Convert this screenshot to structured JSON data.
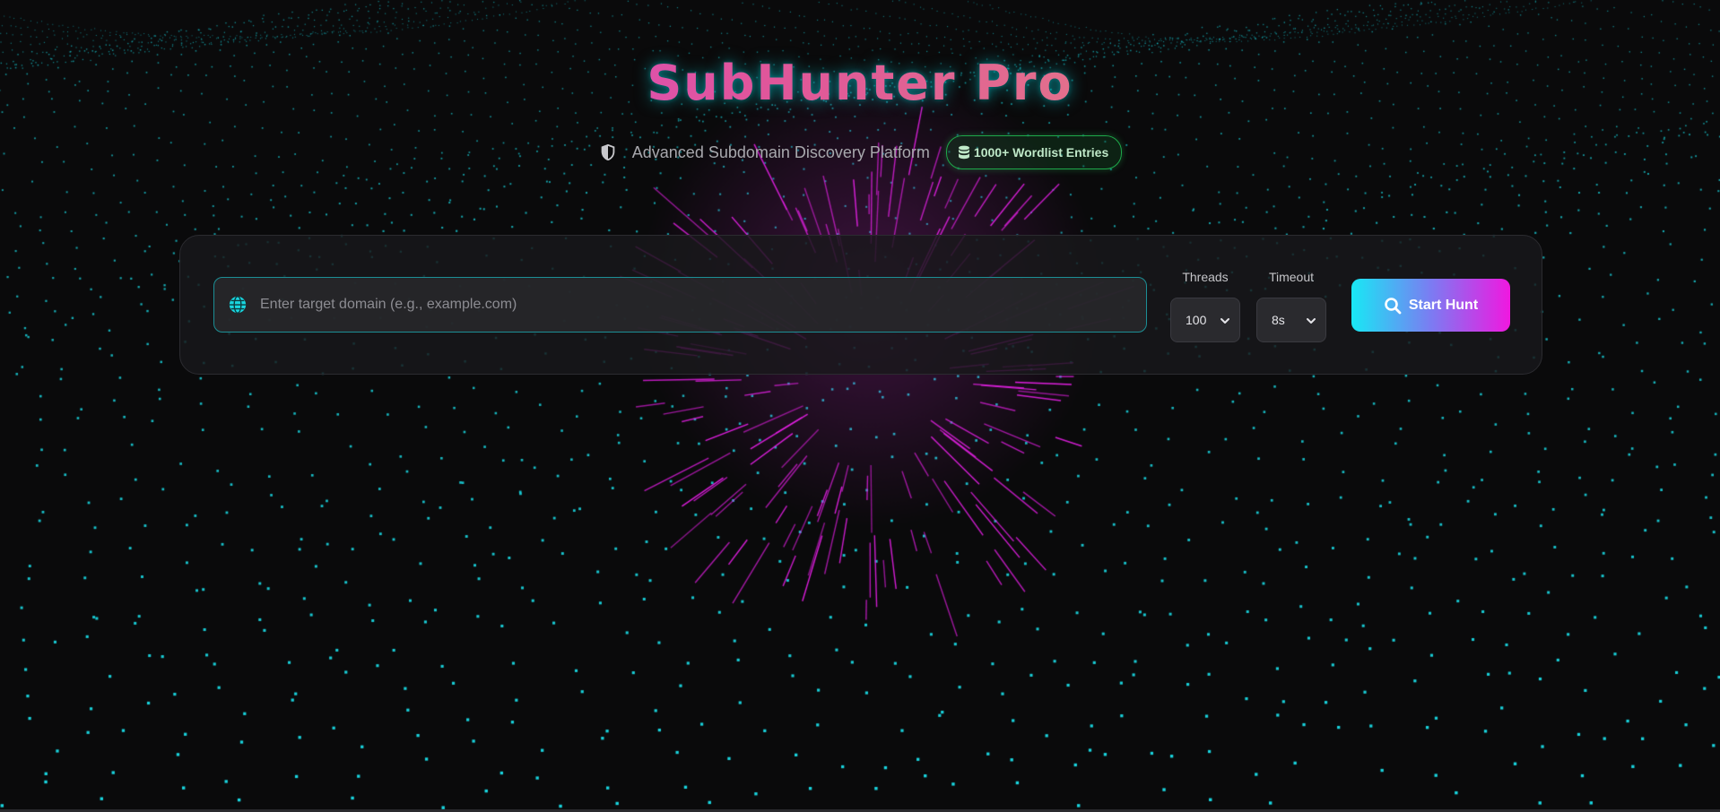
{
  "app": {
    "title": "SubHunter Pro",
    "subtitle": "Advanced Subdomain Discovery Platform",
    "badge": "1000+ Wordlist Entries"
  },
  "search": {
    "placeholder": "Enter target domain (e.g., example.com)",
    "value": ""
  },
  "options": {
    "threads_label": "Threads",
    "threads_value": "100",
    "timeout_label": "Timeout",
    "timeout_value": "8s"
  },
  "actions": {
    "start_label": "Start Hunt"
  },
  "icons": {
    "subtitle": "shield-icon",
    "badge": "database-icon",
    "input": "globe-icon",
    "button": "search-icon",
    "selects": "chevron-down-icon"
  },
  "colors": {
    "background": "#0a0a0b",
    "particle_cyan": "#19d6e0",
    "burst_magenta": "#e01ee0",
    "badge_green": "#1ea84a",
    "input_border": "#1c8e95",
    "button_start": "#18e8f4",
    "button_end": "#f018e0",
    "title_start": "#d53df0",
    "title_end": "#e6a66f"
  }
}
